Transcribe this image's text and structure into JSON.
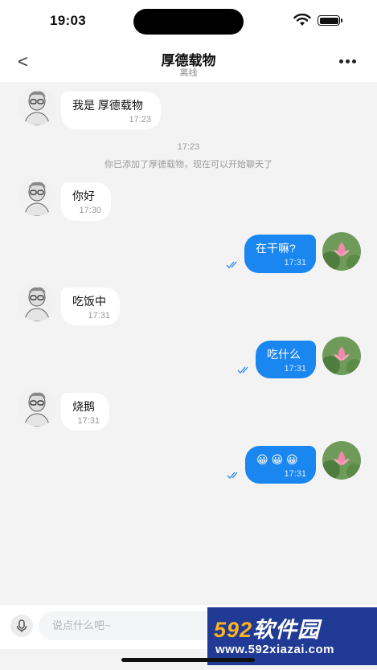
{
  "status_bar": {
    "time": "19:03"
  },
  "header": {
    "back_icon": "<",
    "title": "厚德载物",
    "subtitle": "离线",
    "more_icon": "more-dots"
  },
  "system": {
    "time": "17:23",
    "note": "你已添加了厚德载物，现在可以开始聊天了"
  },
  "messages": [
    {
      "side": "in",
      "text": "我是 厚德载物",
      "time": "17:23"
    },
    {
      "side": "in",
      "text": "你好",
      "time": "17:30"
    },
    {
      "side": "out",
      "text": "在干嘛?",
      "time": "17:31"
    },
    {
      "side": "in",
      "text": "吃饭中",
      "time": "17:31"
    },
    {
      "side": "out",
      "text": "吃什么",
      "time": "17:31"
    },
    {
      "side": "in",
      "text": "烧鹅",
      "time": "17:31"
    },
    {
      "side": "out",
      "text": "😀 😀 😀",
      "time": "17:31"
    }
  ],
  "input": {
    "placeholder": "说点什么吧~"
  },
  "watermark": {
    "brand_number": "592",
    "brand_text": "软件园",
    "url": "www.592xiazai.com"
  },
  "colors": {
    "outgoing_bubble": "#1a86f0",
    "background": "#f3f3f4",
    "watermark_bg": "#203a96",
    "watermark_accent": "#ffb21e"
  }
}
